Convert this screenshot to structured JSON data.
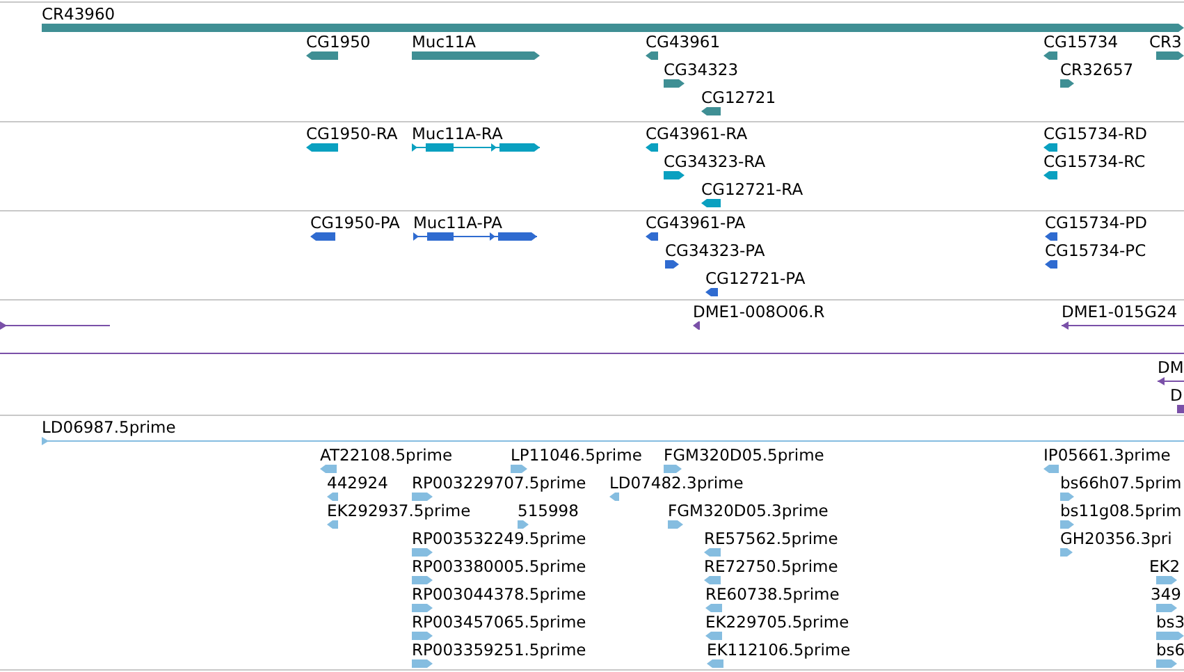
{
  "tracks": [
    {
      "color": "#3f8f94",
      "features": [
        {
          "label": "CR43960",
          "kind": "bar",
          "reverse": false
        },
        {
          "label": "CG1950",
          "kind": "bar",
          "reverse": true
        },
        {
          "label": "Muc11A",
          "kind": "bar",
          "reverse": false
        },
        {
          "label": "CG43961",
          "kind": "bar",
          "reverse": true
        },
        {
          "label": "CG34323",
          "kind": "bar",
          "reverse": false
        },
        {
          "label": "CG12721",
          "kind": "bar",
          "reverse": true
        },
        {
          "label": "CG15734",
          "kind": "bar",
          "reverse": true
        },
        {
          "label": "CR32657",
          "kind": "bar",
          "reverse": false
        },
        {
          "label": "CR3",
          "kind": "bar",
          "reverse": false
        }
      ]
    },
    {
      "color": "#0aa0c0",
      "features": [
        {
          "label": "CG1950-RA",
          "kind": "bar",
          "reverse": true
        },
        {
          "label": "Muc11A-RA",
          "kind": "exons",
          "reverse": false
        },
        {
          "label": "CG43961-RA",
          "kind": "bar",
          "reverse": true
        },
        {
          "label": "CG34323-RA",
          "kind": "bar",
          "reverse": false
        },
        {
          "label": "CG12721-RA",
          "kind": "bar",
          "reverse": true
        },
        {
          "label": "CG15734-RD",
          "kind": "bar",
          "reverse": true
        },
        {
          "label": "CG15734-RC",
          "kind": "bar",
          "reverse": true
        }
      ]
    },
    {
      "color": "#2f6bd0",
      "features": [
        {
          "label": "CG1950-PA",
          "kind": "bar",
          "reverse": true
        },
        {
          "label": "Muc11A-PA",
          "kind": "exons",
          "reverse": false
        },
        {
          "label": "CG43961-PA",
          "kind": "bar",
          "reverse": true
        },
        {
          "label": "CG34323-PA",
          "kind": "bar",
          "reverse": false
        },
        {
          "label": "CG12721-PA",
          "kind": "bar",
          "reverse": true
        },
        {
          "label": "CG15734-PD",
          "kind": "bar",
          "reverse": true
        },
        {
          "label": "CG15734-PC",
          "kind": "bar",
          "reverse": true
        }
      ]
    },
    {
      "color": "#7a50a8",
      "features": [
        {
          "kind": "line",
          "reverse": false
        },
        {
          "label": "DME1-008O06.R",
          "kind": "bar",
          "reverse": true
        },
        {
          "label": "DME1-015G24",
          "kind": "line",
          "reverse": true
        },
        {
          "kind": "plain-line"
        },
        {
          "label": "DM",
          "kind": "line",
          "reverse": true
        },
        {
          "label": "D",
          "kind": "block"
        }
      ]
    },
    {
      "color": "#85bde0",
      "features": [
        {
          "label": "LD06987.5prime",
          "kind": "line",
          "reverse": false
        },
        {
          "label": "AT22108.5prime",
          "kind": "bar",
          "reverse": true
        },
        {
          "label": "LP11046.5prime",
          "kind": "bar",
          "reverse": false
        },
        {
          "label": "FGM320D05.5prime",
          "kind": "bar",
          "reverse": false
        },
        {
          "label": "IP05661.3prime",
          "kind": "bar",
          "reverse": true
        },
        {
          "label": "442924",
          "kind": "bar",
          "reverse": true
        },
        {
          "label": "RP003229707.5prime",
          "kind": "bar",
          "reverse": false
        },
        {
          "label": "LD07482.3prime",
          "kind": "bar",
          "reverse": true
        },
        {
          "label": "bs66h07.5prim",
          "kind": "bar",
          "reverse": false
        },
        {
          "label": "EK292937.5prime",
          "kind": "bar",
          "reverse": true
        },
        {
          "label": "515998",
          "kind": "bar",
          "reverse": false
        },
        {
          "label": "FGM320D05.3prime",
          "kind": "bar",
          "reverse": false
        },
        {
          "label": "bs11g08.5prim",
          "kind": "bar",
          "reverse": false
        },
        {
          "label": "RP003532249.5prime",
          "kind": "bar",
          "reverse": false
        },
        {
          "label": "RE57562.5prime",
          "kind": "bar",
          "reverse": true
        },
        {
          "label": "GH20356.3pri",
          "kind": "bar",
          "reverse": false
        },
        {
          "label": "RP003380005.5prime",
          "kind": "bar",
          "reverse": false
        },
        {
          "label": "RE72750.5prime",
          "kind": "bar",
          "reverse": true
        },
        {
          "label": "EK2",
          "kind": "bar",
          "reverse": false
        },
        {
          "label": "RP003044378.5prime",
          "kind": "bar",
          "reverse": false
        },
        {
          "label": "RE60738.5prime",
          "kind": "bar",
          "reverse": true
        },
        {
          "label": "349",
          "kind": "bar",
          "reverse": false
        },
        {
          "label": "RP003457065.5prime",
          "kind": "bar",
          "reverse": false
        },
        {
          "label": "EK229705.5prime",
          "kind": "bar",
          "reverse": true
        },
        {
          "label": "bs3",
          "kind": "bar",
          "reverse": false
        },
        {
          "label": "RP003359251.5prime",
          "kind": "bar",
          "reverse": false
        },
        {
          "label": "EK112106.5prime",
          "kind": "bar",
          "reverse": true
        },
        {
          "label": "bs6",
          "kind": "bar",
          "reverse": false
        }
      ]
    }
  ]
}
